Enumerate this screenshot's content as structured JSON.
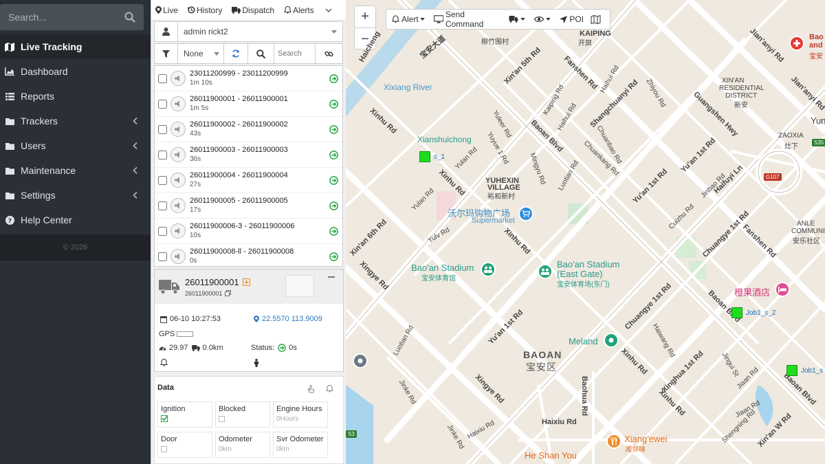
{
  "sidebar": {
    "search_placeholder": "Search...",
    "items": [
      {
        "label": "Live Tracking",
        "icon": "map-icon",
        "active": true
      },
      {
        "label": "Dashboard",
        "icon": "chart-area-icon"
      },
      {
        "label": "Reports",
        "icon": "list-icon"
      },
      {
        "label": "Trackers",
        "icon": "folder-icon",
        "chevron": true
      },
      {
        "label": "Users",
        "icon": "folder-icon",
        "chevron": true
      },
      {
        "label": "Maintenance",
        "icon": "folder-icon",
        "chevron": true
      },
      {
        "label": "Settings",
        "icon": "folder-icon",
        "chevron": true
      },
      {
        "label": "Help Center",
        "icon": "question-icon"
      }
    ],
    "footer": "© 2026"
  },
  "panel": {
    "tabs": [
      "Live",
      "History",
      "Dispatch",
      "Alerts"
    ],
    "user": "admin rickt2",
    "filter": "None",
    "search_placeholder": "Search",
    "devices": [
      {
        "name": "23011200999 - 23011200999",
        "time": "1m 10s"
      },
      {
        "name": "26011900001 - 26011900001",
        "time": "1m 5s"
      },
      {
        "name": "26011900002 - 26011900002",
        "time": "43s"
      },
      {
        "name": "26011900003 - 26011900003",
        "time": "36s"
      },
      {
        "name": "26011900004 - 26011900004",
        "time": "27s"
      },
      {
        "name": "26011900005 - 26011900005",
        "time": "17s"
      },
      {
        "name": "26011900006-3 - 26011900006",
        "time": "10s"
      },
      {
        "name": "26011900008-ll - 26011900008",
        "time": "0s"
      }
    ],
    "detail": {
      "name": "26011900001",
      "sub": "26011900001",
      "datetime": "06-10 10:27:53",
      "location": "22.5570 113.9009",
      "gps": "GPS",
      "speed": "29.97",
      "distance": "0.0km",
      "status_label": "Status:",
      "status_value": "0s"
    },
    "data": {
      "title": "Data",
      "cells": [
        {
          "label": "Ignition",
          "value": "",
          "checked": true
        },
        {
          "label": "Blocked",
          "value": "",
          "checked": false
        },
        {
          "label": "Engine Hours",
          "value": "0Hours"
        },
        {
          "label": "Door",
          "value": "",
          "checked": false
        },
        {
          "label": "Odometer",
          "value": "0km"
        },
        {
          "label": "Svr Odometer",
          "value": "0km"
        }
      ]
    }
  },
  "map": {
    "toolbar": {
      "alert": "Alert",
      "send": "Send Command",
      "poi": "POI"
    },
    "zoom_in": "+",
    "zoom_out": "−",
    "labels": {
      "xixiang_river": "Xixiang River",
      "xianshuichong": "Xianshuichong",
      "yuhexin": "YUHEXIN",
      "village": "VILLAGE",
      "yuhexin_cn": "裕和新村",
      "walmart_cn": "沃尔玛购物广场",
      "supermarket": "Supermarket",
      "stadium": "Bao'an Stadium",
      "stadium_cn": "宝安体育馆",
      "stadium_east": "Bao'an Stadium",
      "east_gate": "(East Gate)",
      "stadium_east_cn": "宝安体育场(东门)",
      "meland": "Meland",
      "baoan": "BAOAN",
      "baoan_cn": "宝安区",
      "orange_hotel": "橙果酒店",
      "xiangewei": "Xiang'ewei",
      "xiangewei_cn": "湘邻味",
      "heshan": "He Shan You",
      "kaiping": "KAIPING",
      "kaiping_cn": "开屏",
      "xinan": "XIN'AN",
      "residential": "RESIDENTIAL",
      "district": "DISTRICT",
      "xinan_cn": "新安",
      "zaoxia": "ZAOXIA",
      "zaoxia_cn": "灶下",
      "anle": "ANLE",
      "communi": "COMMUNI",
      "anle_cn": "安乐社区",
      "liuzhuwei_cn": "柳竹围村",
      "baoan_ave_cn": "宝安大道",
      "bao": "Bao",
      "and": "and",
      "bao_cn": "宝安",
      "yun": "Yun",
      "xinhu_rd": "Xinhu Rd",
      "xinan_5th": "Xin'an 5th Rd",
      "baoan_blvd": "Baoan Blvd",
      "fanshen": "Fanshen Rd",
      "shangchuanyi": "Shangchuanyi Rd",
      "guangshen": "Guangshen Hwy",
      "yuan1st": "Yu'an 1st Rd",
      "chuangye": "Chuangye 1st Rd",
      "xingye": "Xingye Rd",
      "haixiu": "Haixiu Rd",
      "xinhua": "Xinghua 1st Rd",
      "jianyi": "Jian'anyi Rd",
      "xinan6th": "Xin'an 6th Rd",
      "haicheng": "Haicheng",
      "baohua": "Baohua Rd",
      "xinanw": "Xin'an W Rd",
      "luotian": "Luotian Rd",
      "jinke": "Jinke Rd",
      "haiwang": "Haiwang Rd",
      "yulan": "Yulan Rd",
      "yuyue": "Yuyue 1 Rd",
      "yuleer": "Yuleer Rd",
      "kaiping_rd": "Kaiping Rd",
      "haihui": "Haihui Rd",
      "zhiyou": "Zhiyou Rd",
      "chuanbao": "Chuanbao Rd",
      "chuankang": "Chuankang Rd",
      "mingyu": "Mingyu Rd",
      "haifuyi": "Haifuyi Ln",
      "yulv": "Yulv Rd",
      "cuizhu": "Cuizhu Rd",
      "jinbao": "Jinbao Rd",
      "jiaan": "Jiaan Rd",
      "jingui": "Jingui St",
      "shenging": "Shengning Rd",
      "yuanrd": "Yu'an 1st Rd",
      "g107": "G107",
      "s35": "S35",
      "s3": "S3"
    },
    "markers": [
      {
        "label": "s_1"
      },
      {
        "label": "Job1_s_2"
      },
      {
        "label": "Job1_s"
      }
    ]
  }
}
